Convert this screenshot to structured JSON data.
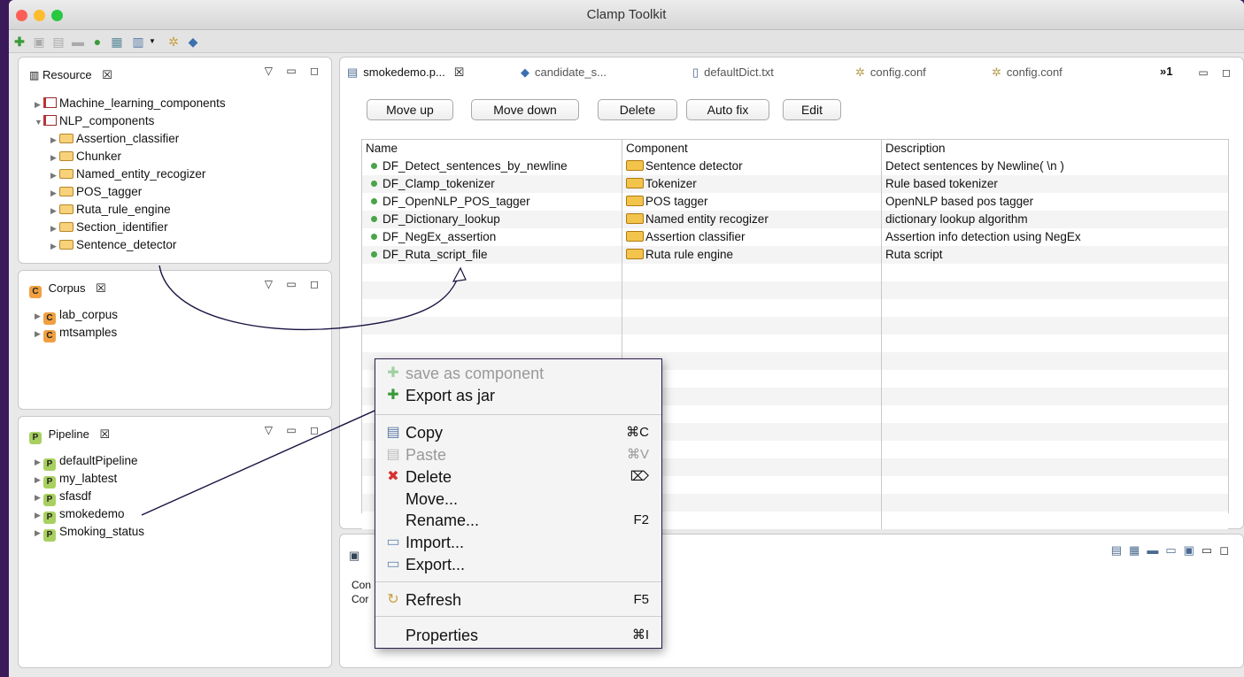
{
  "window": {
    "title": "Clamp Toolkit"
  },
  "resource_panel": {
    "title": "Resource",
    "items": [
      {
        "label": "Machine_learning_components",
        "level": 0,
        "kind": "book",
        "expanded": false
      },
      {
        "label": "NLP_components",
        "level": 0,
        "kind": "book",
        "expanded": true
      },
      {
        "label": "Assertion_classifier",
        "level": 1,
        "kind": "folder",
        "expanded": false
      },
      {
        "label": "Chunker",
        "level": 1,
        "kind": "folder",
        "expanded": false
      },
      {
        "label": "Named_entity_recogizer",
        "level": 1,
        "kind": "folder",
        "expanded": false
      },
      {
        "label": "POS_tagger",
        "level": 1,
        "kind": "folder",
        "expanded": false
      },
      {
        "label": "Ruta_rule_engine",
        "level": 1,
        "kind": "folder",
        "expanded": false
      },
      {
        "label": "Section_identifier",
        "level": 1,
        "kind": "folder",
        "expanded": false
      },
      {
        "label": "Sentence_detector",
        "level": 1,
        "kind": "folder",
        "expanded": false
      }
    ]
  },
  "corpus_panel": {
    "title": "Corpus",
    "badge": "C",
    "items": [
      "lab_corpus",
      "mtsamples"
    ]
  },
  "pipeline_panel": {
    "title": "Pipeline",
    "badge": "P",
    "items": [
      "defaultPipeline",
      "my_labtest",
      "sfasdf",
      "smokedemo",
      "Smoking_status"
    ]
  },
  "editor": {
    "tabs": [
      {
        "label": "smokedemo.p...",
        "icon": "pipeline-editor-icon"
      },
      {
        "label": "candidate_s...",
        "icon": "ruta-icon"
      },
      {
        "label": "defaultDict.txt",
        "icon": "text-file-icon"
      },
      {
        "label": "config.conf",
        "icon": "gear-icon"
      },
      {
        "label": "config.conf",
        "icon": "gear-icon"
      }
    ],
    "overflow": "»1",
    "buttons": [
      "Move up",
      "Move down",
      "Delete",
      "Auto fix",
      "Edit"
    ],
    "columns": [
      "Name",
      "Component",
      "Description"
    ],
    "rows": [
      [
        "DF_Detect_sentences_by_newline",
        "Sentence detector",
        "Detect sentences by Newline( \\n )"
      ],
      [
        "DF_Clamp_tokenizer",
        "Tokenizer",
        "Rule based tokenizer"
      ],
      [
        "DF_OpenNLP_POS_tagger",
        "POS tagger",
        "OpenNLP based pos tagger"
      ],
      [
        "DF_Dictionary_lookup",
        "Named entity recogizer",
        "dictionary lookup algorithm"
      ],
      [
        "DF_NegEx_assertion",
        "Assertion classifier",
        "Assertion info detection using NegEx"
      ],
      [
        "DF_Ruta_script_file",
        "Ruta rule engine",
        "Ruta script"
      ]
    ]
  },
  "console": {
    "line1": "Con",
    "line2": "Cor"
  },
  "context_menu": {
    "items": [
      {
        "label": "save as component",
        "icon": "plus-icon",
        "disabled": true
      },
      {
        "label": "Export as jar",
        "icon": "plus-icon",
        "disabled": false
      },
      {
        "label": "Copy",
        "shortcut": "⌘C",
        "icon": "copy-icon",
        "disabled": false
      },
      {
        "label": "Paste",
        "shortcut": "⌘V",
        "icon": "paste-icon",
        "disabled": true
      },
      {
        "label": "Delete",
        "shortcut": "⌦",
        "icon": "delete-icon",
        "disabled": false
      },
      {
        "label": "Move...",
        "disabled": false
      },
      {
        "label": "Rename...",
        "shortcut": "F2",
        "disabled": false
      },
      {
        "label": "Import...",
        "icon": "import-icon",
        "disabled": false
      },
      {
        "label": "Export...",
        "icon": "export-icon",
        "disabled": false
      },
      {
        "label": "Refresh",
        "shortcut": "F5",
        "icon": "refresh-icon",
        "disabled": false
      },
      {
        "label": "Properties",
        "shortcut": "⌘I",
        "disabled": false
      }
    ]
  },
  "colors": {
    "background": "#3b1a5a",
    "corpus_badge": "#f0a040",
    "pipeline_badge": "#a8d060",
    "status_dot": "#4aa44a"
  }
}
